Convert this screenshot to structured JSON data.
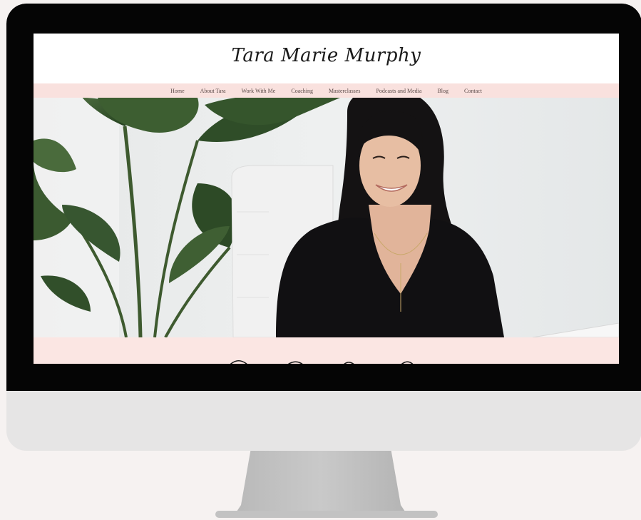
{
  "site": {
    "logo_text": "Tara Marie Murphy"
  },
  "nav": {
    "items": [
      {
        "label": "Home"
      },
      {
        "label": "About Tara"
      },
      {
        "label": "Work With Me"
      },
      {
        "label": "Coaching"
      },
      {
        "label": "Masterclasses"
      },
      {
        "label": "Podcasts and Media"
      },
      {
        "label": "Blog"
      },
      {
        "label": "Contact"
      }
    ]
  },
  "colors": {
    "nav_background": "#f9e1de",
    "band_background": "#fbe6e3",
    "bezel": "#050505",
    "monitor_body": "#e6e5e5",
    "stand": "#c2c2c2",
    "page_background": "#f6f2f1"
  },
  "hero": {
    "subject": "woman smiling with long dark hair, black top, seated in white office chair beside large green plant"
  }
}
